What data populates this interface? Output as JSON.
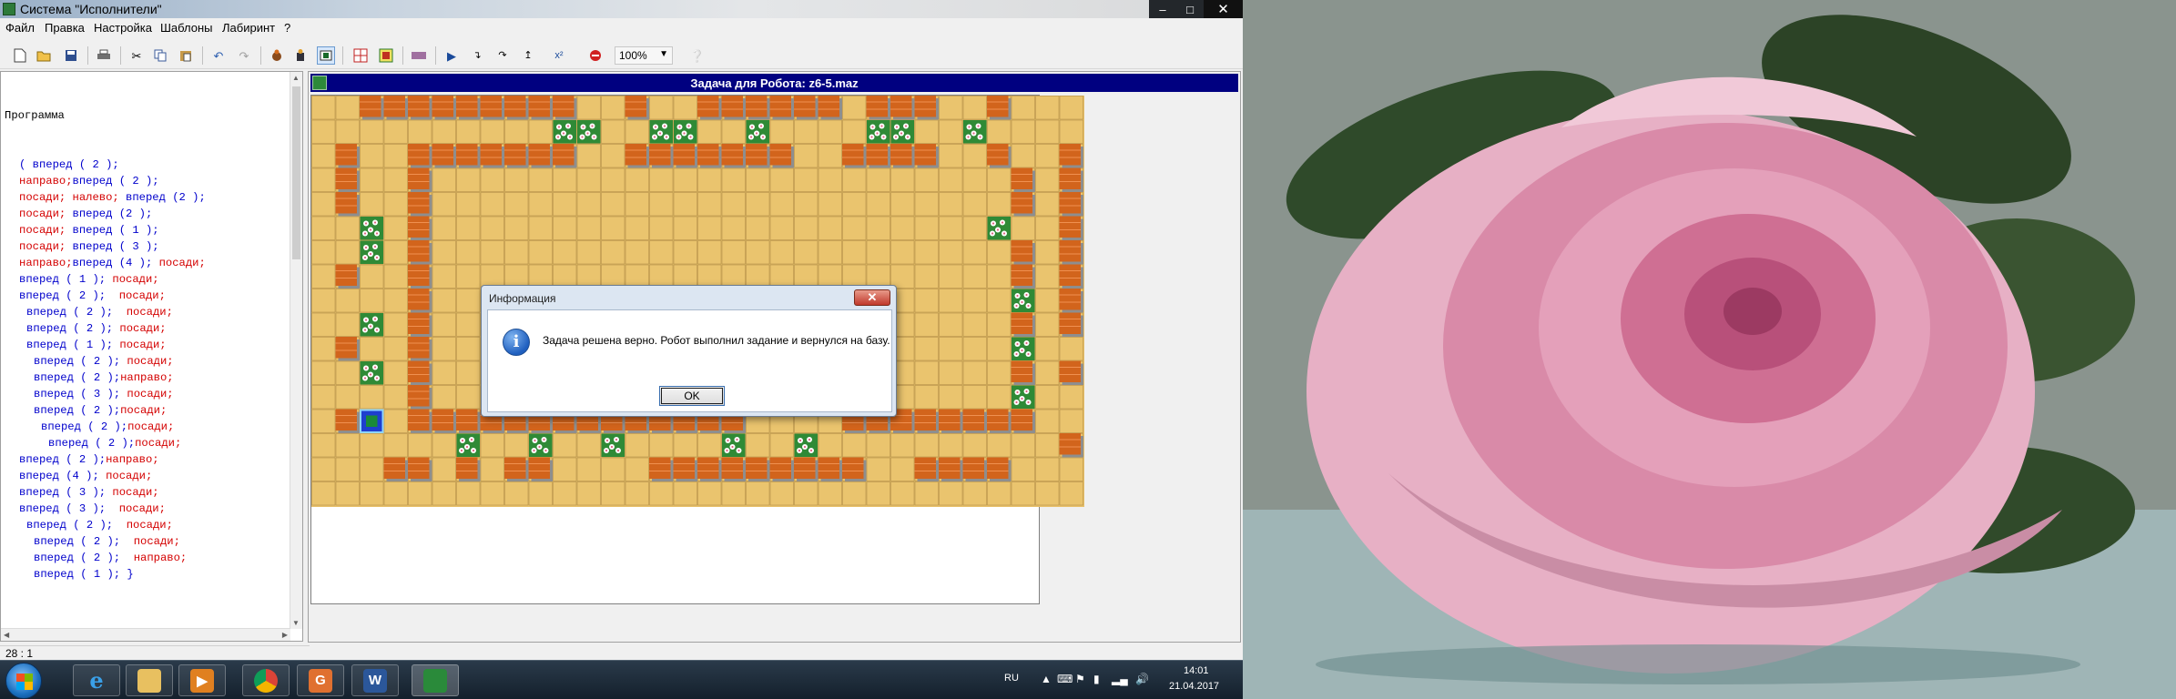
{
  "window": {
    "title": "Система \"Исполнители\"",
    "controls": {
      "minimize": "–",
      "maximize": "□",
      "close": "✕"
    }
  },
  "menu": [
    "Файл",
    "Правка",
    "Настройка",
    "Шаблоны",
    "Лабиринт",
    "?"
  ],
  "toolbar": {
    "icons": [
      "new-file-icon",
      "open-folder-icon",
      "save-icon",
      "print-icon",
      "cut-icon",
      "copy-icon",
      "paste-icon",
      "undo-icon",
      "redo-icon",
      "robot-executor-icon",
      "robot-run-icon",
      "robot-task-icon",
      "maze-grid-icon",
      "maze-edit-icon",
      "stop-sign-icon",
      "run-icon",
      "step-into-icon",
      "step-over-icon",
      "step-out-icon",
      "reset-icon",
      "stop-icon",
      "help-icon"
    ],
    "zoom": "100%"
  },
  "code": {
    "header": "Программа",
    "lines": [
      [
        2,
        [
          [
            "n",
            "( вперед ( 2 );"
          ]
        ]
      ],
      [
        2,
        [
          [
            "k",
            "направо;"
          ],
          [
            "n",
            "вперед ( 2 );"
          ]
        ]
      ],
      [
        2,
        [
          [
            "k",
            "посади;"
          ],
          [
            "k",
            " налево;"
          ],
          [
            "n",
            " вперед (2 );"
          ]
        ]
      ],
      [
        2,
        [
          [
            "k",
            "посади;"
          ],
          [
            "n",
            " вперед (2 );"
          ]
        ]
      ],
      [
        2,
        [
          [
            "k",
            "посади;"
          ],
          [
            "n",
            " вперед ( 1 );"
          ]
        ]
      ],
      [
        2,
        [
          [
            "k",
            "посади;"
          ],
          [
            "n",
            " вперед ( 3 );"
          ]
        ]
      ],
      [
        2,
        [
          [
            "k",
            "направо;"
          ],
          [
            "n",
            "вперед (4 );"
          ],
          [
            "k",
            " посади;"
          ]
        ]
      ],
      [
        2,
        [
          [
            "n",
            "вперед ( 1 );"
          ],
          [
            "k",
            " посади;"
          ]
        ]
      ],
      [
        2,
        [
          [
            "n",
            "вперед ( 2 ); "
          ],
          [
            "k",
            " посади;"
          ]
        ]
      ],
      [
        3,
        [
          [
            "n",
            "вперед ( 2 ); "
          ],
          [
            "k",
            " посади;"
          ]
        ]
      ],
      [
        3,
        [
          [
            "n",
            "вперед ( 2 );"
          ],
          [
            "k",
            " посади;"
          ]
        ]
      ],
      [
        3,
        [
          [
            "n",
            "вперед ( 1 );"
          ],
          [
            "k",
            " посади;"
          ]
        ]
      ],
      [
        4,
        [
          [
            "n",
            "вперед ( 2 );"
          ],
          [
            "k",
            " посади;"
          ]
        ]
      ],
      [
        4,
        [
          [
            "n",
            "вперед ( 2 );"
          ],
          [
            "k",
            "направо;"
          ]
        ]
      ],
      [
        4,
        [
          [
            "n",
            "вперед ( 3 );"
          ],
          [
            "k",
            " посади;"
          ]
        ]
      ],
      [
        4,
        [
          [
            "n",
            "вперед ( 2 );"
          ],
          [
            "k",
            "посади;"
          ]
        ]
      ],
      [
        5,
        [
          [
            "n",
            "вперед ( 2 );"
          ],
          [
            "k",
            "посади;"
          ]
        ]
      ],
      [
        6,
        [
          [
            "n",
            "вперед ( 2 );"
          ],
          [
            "k",
            "посади;"
          ]
        ]
      ],
      [
        2,
        [
          [
            "n",
            "вперед ( 2 );"
          ],
          [
            "k",
            "направо;"
          ]
        ]
      ],
      [
        2,
        [
          [
            "n",
            "вперед (4 );"
          ],
          [
            "k",
            " посади;"
          ]
        ]
      ],
      [
        2,
        [
          [
            "n",
            "вперед ( 3 );"
          ],
          [
            "k",
            " посади;"
          ]
        ]
      ],
      [
        2,
        [
          [
            "n",
            "вперед ( 3 ); "
          ],
          [
            "k",
            " посади;"
          ]
        ]
      ],
      [
        3,
        [
          [
            "n",
            "вперед ( 2 ); "
          ],
          [
            "k",
            " посади;"
          ]
        ]
      ],
      [
        4,
        [
          [
            "n",
            "вперед ( 2 ); "
          ],
          [
            "k",
            " посади;"
          ]
        ]
      ],
      [
        4,
        [
          [
            "n",
            "вперед ( 2 ); "
          ],
          [
            "k",
            " направо;"
          ]
        ]
      ],
      [
        4,
        [
          [
            "n",
            "вперед ( 1 ); }"
          ]
        ]
      ]
    ]
  },
  "status": {
    "cursor": "28 : 1"
  },
  "task": {
    "title": "Задача для Робота: z6-5.maz",
    "maze": {
      "rows": [
        "..WWWWWWWWW..W..WWWWWW.WWW..W...",
        "..........GG..GG..G....GG..G....",
        ".W..WWWWWWW..WWWWWWW..WWWW..W..W",
        ".W..W........................W.W",
        ".W..W........................W.W",
        "..G.W.......................G..W",
        "..G.W........................W.W",
        ".W..W........................W.W",
        "....W........................G.W",
        "..G.W........................W.W",
        ".W..W........................G..",
        "..G.W........................W.W",
        "....W........................G..",
        ".WR.WWWWWWWWWWWWWW....WWWWWWWW..",
        "......G..G..G....G..G..........W",
        "...WW.W.WW....WWWWWWWWW..WWWW...",
        "................................"
      ]
    }
  },
  "dialog": {
    "title": "Информация",
    "close": "✕",
    "icon_letter": "i",
    "message": "Задача решена верно. Робот выполнил задание и вернулся на базу.",
    "ok": "OK"
  },
  "taskbar": {
    "lang": "RU",
    "time": "14:01",
    "date": "21.04.2017",
    "apps": [
      "internet-explorer-icon",
      "file-explorer-icon",
      "media-player-icon",
      "chrome-icon",
      "pdf-reader-icon",
      "word-icon",
      "robot-app-icon"
    ]
  }
}
